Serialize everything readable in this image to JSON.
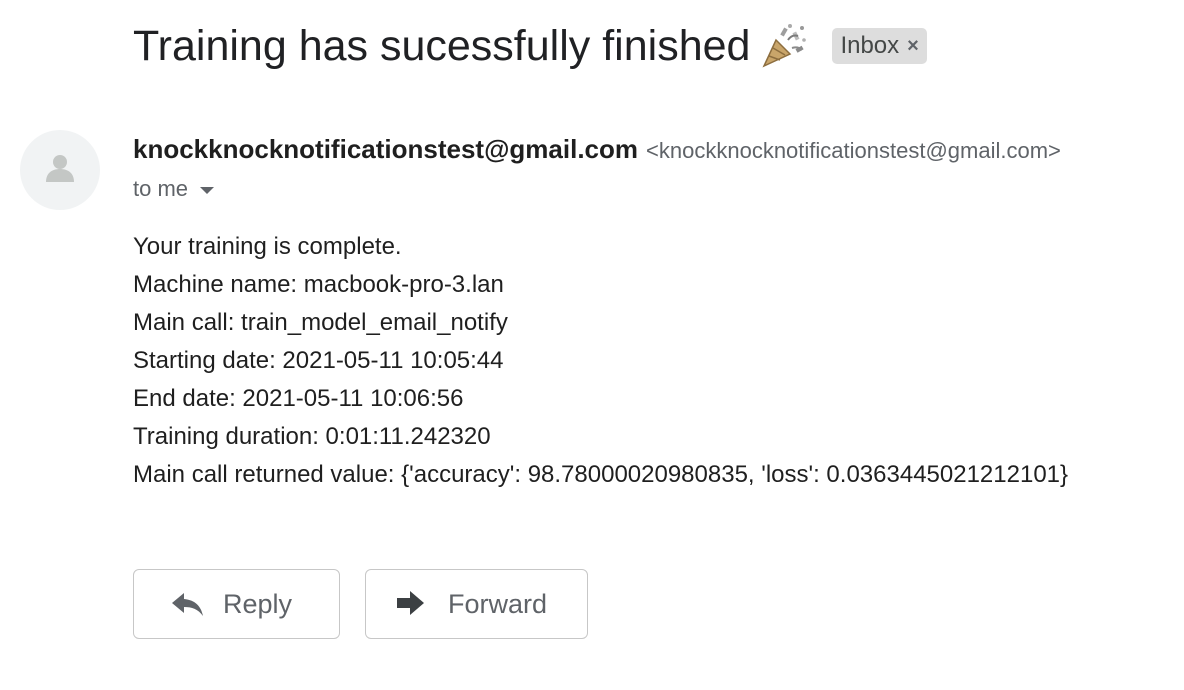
{
  "email": {
    "subject": "Training has sucessfully finished",
    "subject_emoji": "party-popper-icon",
    "label": {
      "name": "Inbox",
      "remove_glyph": "×"
    },
    "sender": {
      "name": "knockknocknotificationstest@gmail.com",
      "address": "<knockknocknotificationstest@gmail.com>",
      "avatar": "default-person-avatar"
    },
    "recipient_text": "to me",
    "body_lines": [
      "Your training is complete.",
      "Machine name: macbook-pro-3.lan",
      "Main call: train_model_email_notify",
      "Starting date: 2021-05-11 10:05:44",
      "End date: 2021-05-11 10:06:56",
      "Training duration: 0:01:11.242320",
      "Main call returned value: {'accuracy': 98.78000020980835, 'loss': 0.0363445021212101}"
    ]
  },
  "actions": {
    "reply": {
      "label": "Reply",
      "icon": "reply-arrow-icon"
    },
    "forward": {
      "label": "Forward",
      "icon": "forward-arrow-icon"
    }
  },
  "colors": {
    "text_primary": "#202124",
    "text_secondary": "#5f6368",
    "label_chip_bg": "#dddddd",
    "button_border": "#c7c7c7",
    "avatar_bg": "#f1f3f4",
    "avatar_fg": "#c4c7c5"
  }
}
